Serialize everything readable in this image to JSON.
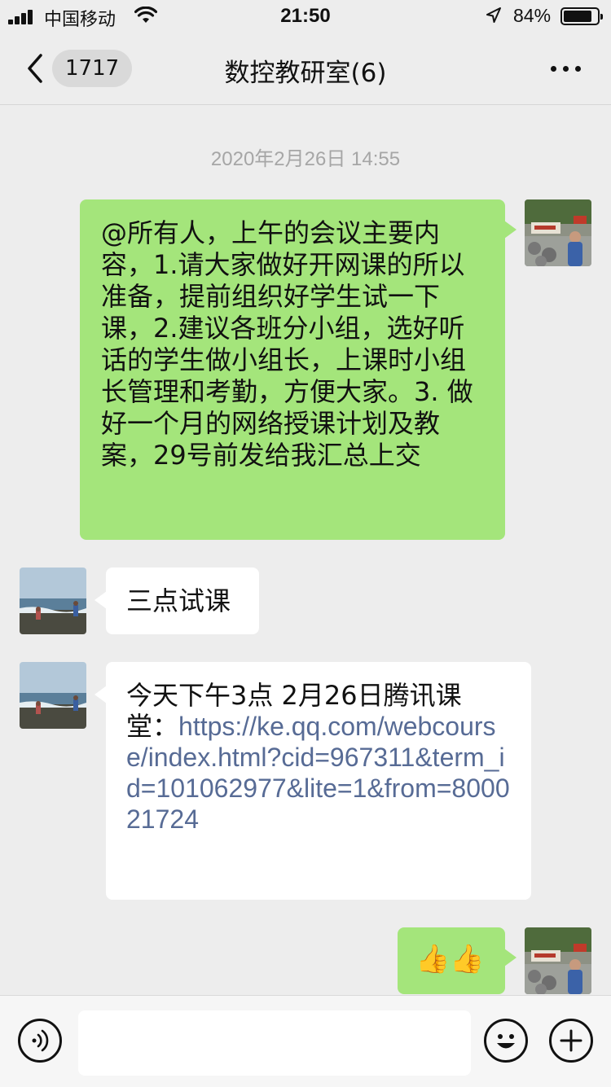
{
  "status_bar": {
    "carrier": "中国移动",
    "time": "21:50",
    "battery_percent": "84%",
    "battery_level": 0.84,
    "icons": [
      "signal-icon",
      "wifi-icon",
      "location-arrow-icon",
      "battery-icon"
    ]
  },
  "nav": {
    "unread_count": "1717",
    "title": "数控教研室(6)",
    "icons": [
      "chevron-left-icon",
      "more-icon"
    ]
  },
  "chat": {
    "timestamp": "2020年2月26日 14:55",
    "messages": [
      {
        "side": "me",
        "text": "@所有人，上午的会议主要内容，1.请大家做好开网课的所以准备，提前组织好学生试一下课，2.建议各班分小组，选好听话的学生做小组长，上课时小组长管理和考勤，方便大家。3. 做好一个月的网络授课计划及教案，29号前发给我汇总上交"
      },
      {
        "side": "other",
        "text": "三点试课"
      },
      {
        "side": "other",
        "text": "今天下午3点  2月26日腾讯课堂：",
        "link": "https://ke.qq.com/webcourse/index.html?cid=967311&term_id=101062977&lite=1&from=800021724"
      },
      {
        "side": "me",
        "emoji": "👍👍"
      }
    ]
  },
  "input_bar": {
    "icons": [
      "voice-icon",
      "emoji-icon",
      "plus-icon"
    ]
  },
  "colors": {
    "background": "#ededed",
    "my_bubble": "#a4e57b",
    "other_bubble": "#ffffff",
    "link": "#576b95",
    "timestamp": "#a6a6a6"
  }
}
